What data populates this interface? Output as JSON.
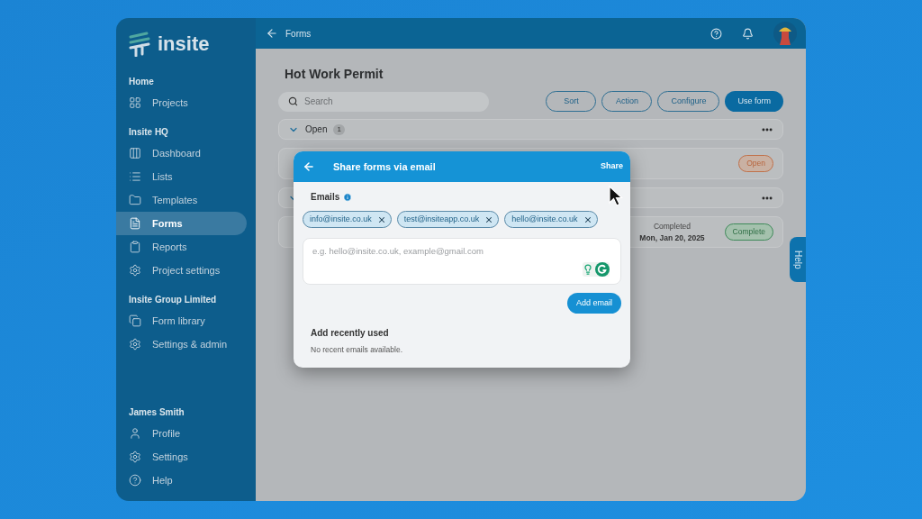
{
  "logo": "insite",
  "sidebar": {
    "sections": [
      {
        "heading": "Home",
        "items": [
          {
            "label": "Projects",
            "selected": false
          }
        ]
      },
      {
        "heading": "Insite HQ",
        "items": [
          {
            "label": "Dashboard",
            "selected": false
          },
          {
            "label": "Lists",
            "selected": false
          },
          {
            "label": "Templates",
            "selected": false
          },
          {
            "label": "Forms",
            "selected": true
          },
          {
            "label": "Reports",
            "selected": false
          },
          {
            "label": "Project settings",
            "selected": false
          }
        ]
      },
      {
        "heading": "Insite Group Limited",
        "items": [
          {
            "label": "Form library",
            "selected": false
          },
          {
            "label": "Settings & admin",
            "selected": false
          }
        ]
      }
    ],
    "user_section": {
      "heading": "James Smith",
      "items": [
        {
          "label": "Profile",
          "selected": false
        },
        {
          "label": "Settings",
          "selected": false
        },
        {
          "label": "Help",
          "selected": false
        }
      ]
    }
  },
  "topbar": {
    "title": "Forms"
  },
  "page": {
    "title": "Hot Work Permit",
    "search": {
      "placeholder": "Search"
    },
    "buttons": [
      {
        "label": "Sort",
        "kind": "outline"
      },
      {
        "label": "Action",
        "kind": "outline"
      },
      {
        "label": "Configure",
        "kind": "outline"
      },
      {
        "label": "Use form",
        "kind": "primary"
      }
    ],
    "groups": [
      {
        "label": "Open",
        "count": "1",
        "expanded": true,
        "rows": [
          {
            "kind": "open",
            "badge": "Open"
          }
        ]
      },
      {
        "expanded": true,
        "rows": [
          {
            "kind": "complete",
            "status": "Completed",
            "date": "Mon, Jan 20, 2025",
            "badge": "Complete"
          }
        ]
      }
    ]
  },
  "help_tab": "Help",
  "dialog": {
    "title": "Share forms via email",
    "action": "Share",
    "emails_label": "Emails",
    "chips": [
      "info@insite.co.uk",
      "test@insiteapp.co.uk",
      "hello@insite.co.uk"
    ],
    "input": {
      "placeholder": "e.g. hello@insite.co.uk, example@gmail.com"
    },
    "add_button": "Add email",
    "recent_heading": "Add recently used",
    "recent_empty": "No recent emails available."
  }
}
